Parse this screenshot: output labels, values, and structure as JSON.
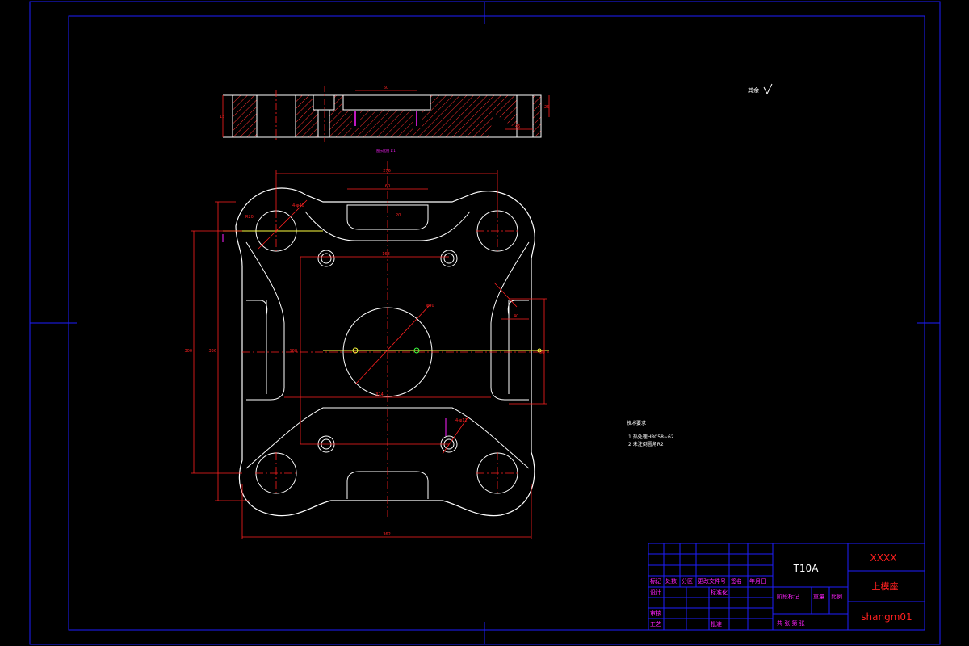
{
  "drawing": {
    "roughness_symbol": "其余",
    "section_label": "图示比例 1:1",
    "dims": {
      "top_view_width": "60",
      "top_view_height": "15",
      "top_view_slot": "25",
      "top_view_side": "45",
      "width_276": "276",
      "width_362": "362",
      "width_324": "324",
      "width_168": "168",
      "height_336": "336",
      "height_300": "300",
      "height_280": "280",
      "height_168": "168",
      "slot_width": "60",
      "slot_depth": "20",
      "hole_r": "R20",
      "hole_4": "4-φ40",
      "center_dia": "φ90",
      "small_hole": "4-φ12",
      "side_45": "40",
      "side_90": "90"
    },
    "tech_requirements": {
      "title": "技术要求",
      "items": [
        "1  热处理HRC58~62",
        "2  未注倒圆角R2"
      ]
    }
  },
  "title_block": {
    "material": "T10A",
    "company": "XXXX",
    "part_name": "上模座",
    "drawing_no": "shangm01",
    "row_labels": [
      "标记",
      "处数",
      "分区",
      "更改文件号",
      "签名",
      "年月日"
    ],
    "designer": "设计",
    "standardize": "标准化",
    "checker": "审核",
    "process": "工艺",
    "approve": "批准",
    "stage_mark": "阶段标记",
    "weight": "重量",
    "scale": "比例",
    "sheets": "共    张 第    张"
  },
  "colors": {
    "frame": "#1e1eff",
    "outline": "#ffffff",
    "dimension": "#ff2020",
    "center": "#ff2020",
    "yellow": "#ffff40",
    "magenta": "#ff20ff",
    "hatch": "#ff3030"
  }
}
